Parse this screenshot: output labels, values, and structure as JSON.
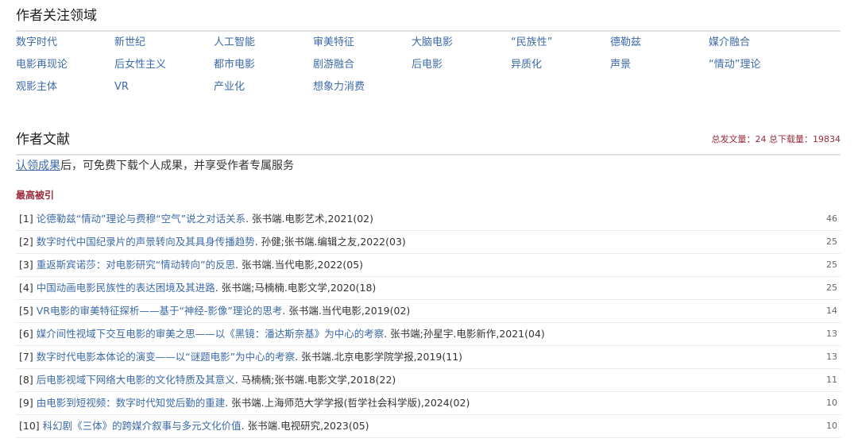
{
  "focus": {
    "title": "作者关注领域",
    "topics": [
      "数字时代",
      "新世纪",
      "人工智能",
      "审美特征",
      "大脑电影",
      "“民族性”",
      "德勒兹",
      "媒介融合",
      "电影再现论",
      "后女性主义",
      "都市电影",
      "剧游融合",
      "后电影",
      "异质化",
      "声景",
      "“情动”理论",
      "观影主体",
      "VR",
      "产业化",
      "想象力消费"
    ]
  },
  "works": {
    "title": "作者文献",
    "stats": "总发文量：24  总下载量：19834",
    "claim_link": "认领成果",
    "claim_rest": "后，可免费下载个人成果，并享受作者专属服务",
    "subhead": "最高被引",
    "refs": [
      {
        "idx": "[1]",
        "title": "论德勒兹“情动”理论与费穆“空气”说之对话关系",
        "meta": ". 张书端.电影艺术,2021(02)",
        "cites": "46"
      },
      {
        "idx": "[2]",
        "title": "数字时代中国纪录片的声景转向及其具身传播趋势",
        "meta": ". 孙健;张书端.编辑之友,2022(03)",
        "cites": "25"
      },
      {
        "idx": "[3]",
        "title": "重返斯宾诺莎：对电影研究“情动转向”的反思",
        "meta": ". 张书端.当代电影,2022(05)",
        "cites": "25"
      },
      {
        "idx": "[4]",
        "title": "中国动画电影民族性的表达困境及其进路",
        "meta": ". 张书端;马楠楠.电影文学,2020(18)",
        "cites": "25"
      },
      {
        "idx": "[5]",
        "title": "VR电影的审美特征探析——基于“神经-影像”理论的思考",
        "meta": ". 张书端.当代电影,2019(02)",
        "cites": "14"
      },
      {
        "idx": "[6]",
        "title": "媒介间性视域下交互电影的审美之思——以《黑镜：潘达斯奈基》为中心的考察",
        "meta": ". 张书端;孙星宇.电影新作,2021(04)",
        "cites": "13"
      },
      {
        "idx": "[7]",
        "title": "数字时代电影本体论的演变——以“谜题电影”为中心的考察",
        "meta": ". 张书端.北京电影学院学报,2019(11)",
        "cites": "13"
      },
      {
        "idx": "[8]",
        "title": "后电影视域下网络大电影的文化特质及其意义",
        "meta": ". 马楠楠;张书端.电影文学,2018(22)",
        "cites": "11"
      },
      {
        "idx": "[9]",
        "title": "由电影到短视频：数字时代知觉后勤的重建",
        "meta": ". 张书端.上海师范大学学报(哲学社会科学版),2024(02)",
        "cites": "10"
      },
      {
        "idx": "[10]",
        "title": "科幻剧《三体》的跨媒介叙事与多元文化价值",
        "meta": ". 张书端.电视研究,2023(05)",
        "cites": "10"
      }
    ]
  }
}
